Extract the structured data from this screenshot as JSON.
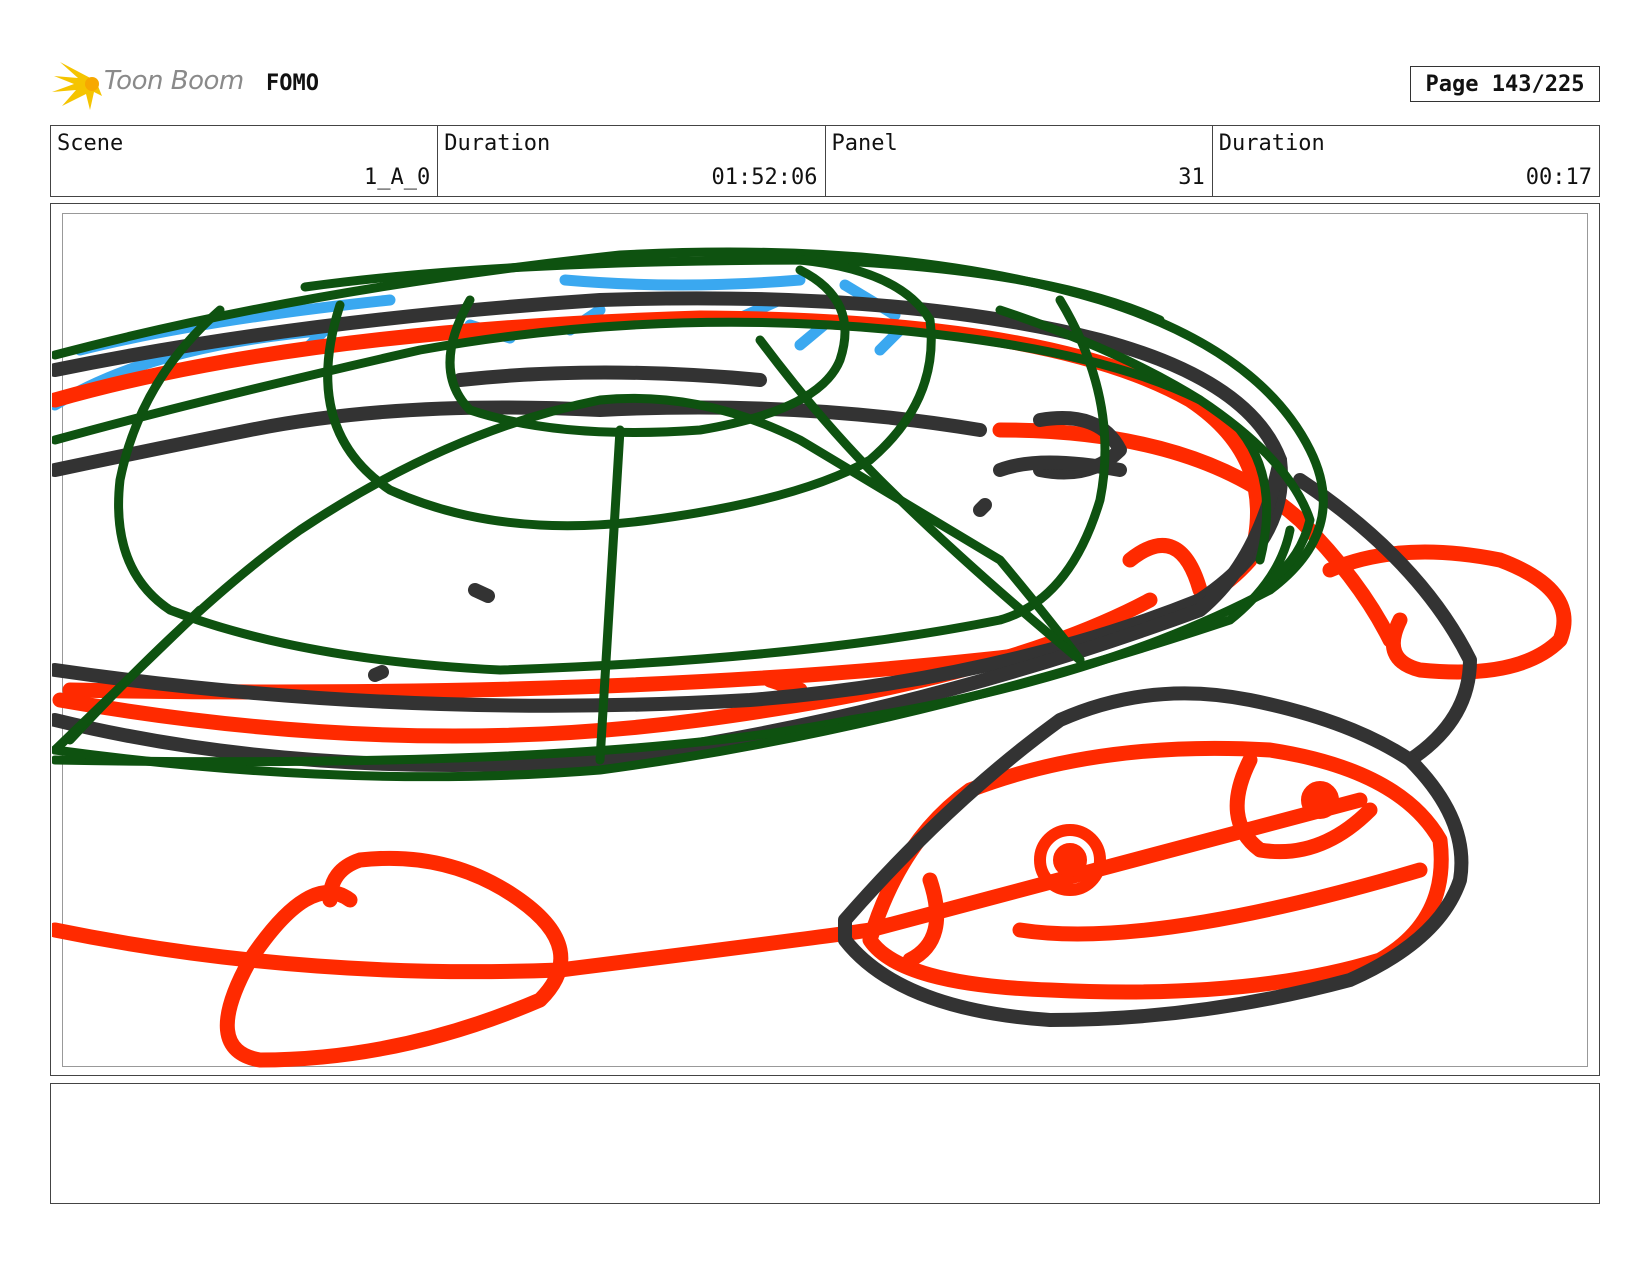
{
  "header": {
    "brand": "Toon Boom",
    "project": "FOMO",
    "page_label": "Page 143/225"
  },
  "info": {
    "scene_label": "Scene",
    "scene_value": "1_A_0",
    "duration_label": "Duration",
    "duration_value": "01:52:06",
    "panel_label": "Panel",
    "panel_value": "31",
    "panel_duration_label": "Duration",
    "panel_duration_value": "00:17"
  },
  "notes": {
    "text": ""
  },
  "colors": {
    "red": "#ff2a00",
    "dark": "#333333",
    "green": "#0e5210",
    "blue": "#3aa8f0",
    "logo": "#f5c400"
  }
}
